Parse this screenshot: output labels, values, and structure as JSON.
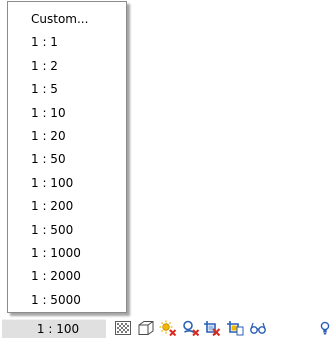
{
  "scale_menu": {
    "items": [
      "Custom...",
      "1 : 1",
      "1 : 2",
      "1 : 5",
      "1 : 10",
      "1 : 20",
      "1 : 50",
      "1 : 100",
      "1 : 200",
      "1 : 500",
      "1 : 1000",
      "1 : 2000",
      "1 : 5000"
    ]
  },
  "status_bar": {
    "scale_value": "1 : 100",
    "icons": [
      "detail-level-icon",
      "visual-style-icon",
      "sun-path-icon",
      "shadows-icon",
      "crop-view-icon",
      "show-crop-region-icon",
      "temporary-hide-icon",
      "reveal-hidden-icon"
    ]
  },
  "colors": {
    "menu_border": "#8c8c8c",
    "status_background": "#e0e0e0",
    "icon_blue": "#2a5fb5",
    "icon_red": "#d62a1e",
    "icon_yellow": "#f2b800"
  }
}
